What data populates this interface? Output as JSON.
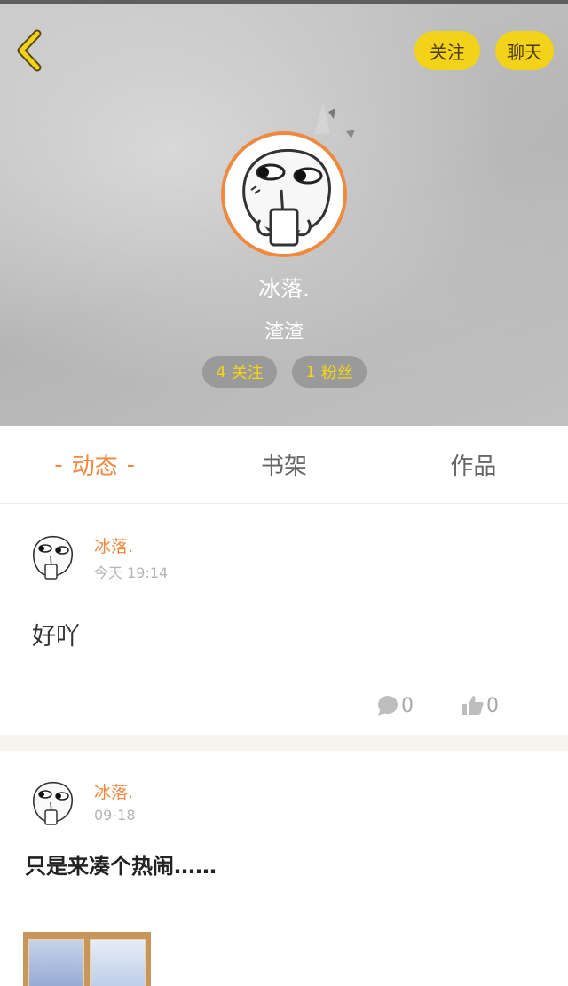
{
  "header": {
    "follow_label": "关注",
    "chat_label": "聊天",
    "user_name": "冰落.",
    "user_signature": "渣渣",
    "following_count": "4",
    "following_label": "关注",
    "fans_count": "1",
    "fans_label": "粉丝"
  },
  "tabs": [
    {
      "label": "动态",
      "active": true
    },
    {
      "label": "书架",
      "active": false
    },
    {
      "label": "作品",
      "active": false
    }
  ],
  "tab_active_marker": "-",
  "posts": [
    {
      "author": "冰落.",
      "time": "今天 19:14",
      "text": "好吖",
      "comment_count": "0",
      "like_count": "0"
    },
    {
      "author": "冰落.",
      "time": "09-18",
      "text": "只是来凑个热闹……"
    }
  ],
  "colors": {
    "accent_orange": "#f0883e",
    "accent_yellow": "#f3d21a",
    "separator": "#f4f3ee"
  },
  "icons": {
    "back": "chevron-left-icon",
    "comment": "comment-bubble-icon",
    "like": "thumbs-up-icon"
  }
}
